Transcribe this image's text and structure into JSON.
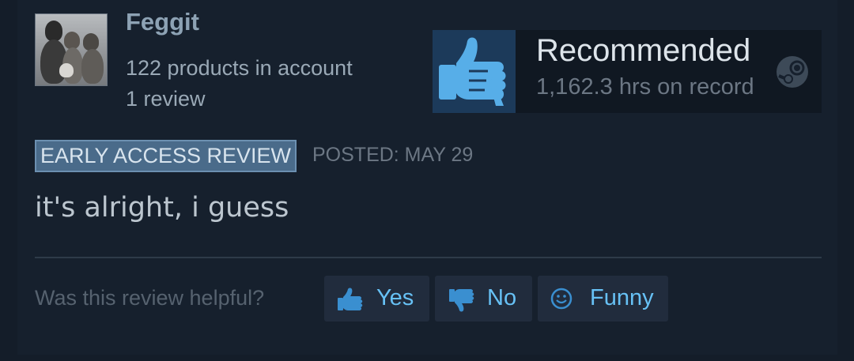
{
  "author": {
    "name": "Feggit",
    "products": "122 products in account",
    "reviews": "1 review"
  },
  "verdict": {
    "label": "Recommended",
    "hours": "1,162.3 hrs on record",
    "icon": "thumbs-up-icon"
  },
  "meta": {
    "badge": "EARLY ACCESS REVIEW",
    "posted": "POSTED: MAY 29"
  },
  "review": {
    "text": "it's alright, i guess"
  },
  "helpful": {
    "question": "Was this review helpful?",
    "yes": "Yes",
    "no": "No",
    "funny": "Funny"
  },
  "colors": {
    "background": "#16202d",
    "accent": "#67c1f5",
    "badge": "#4a6b8a"
  }
}
